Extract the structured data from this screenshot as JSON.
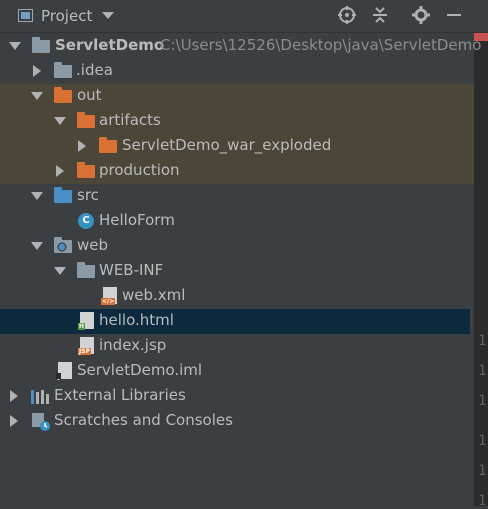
{
  "header": {
    "title": "Project",
    "icons": [
      "target-icon",
      "collapse-icon",
      "gear-icon",
      "minimize-icon"
    ]
  },
  "tree": {
    "root": {
      "name": "ServletDemo",
      "path": "C:\\Users\\12526\\Desktop\\java\\ServletDemo"
    },
    "idea": "idea",
    "idea_prefix": ".",
    "out": "out",
    "artifacts": "artifacts",
    "war_exploded": "ServletDemo_war_exploded",
    "production": "production",
    "src": "src",
    "helloform": "HelloForm",
    "web": "web",
    "webinf": "WEB-INF",
    "webxml": "web.xml",
    "hellohtml": "hello.html",
    "indexjsp": "index.jsp",
    "iml": "ServletDemo.iml",
    "external_libraries": "External Libraries",
    "scratches": "Scratches and Consoles"
  },
  "gutter": {
    "numbers": [
      "1",
      "1",
      "1",
      "1",
      "1",
      "1"
    ]
  },
  "colors": {
    "background": "#3c3f41",
    "selected": "#0d293e",
    "highlight": "#4b4638",
    "folder_orange": "#d97134",
    "folder_blue": "#4a8fc7"
  }
}
